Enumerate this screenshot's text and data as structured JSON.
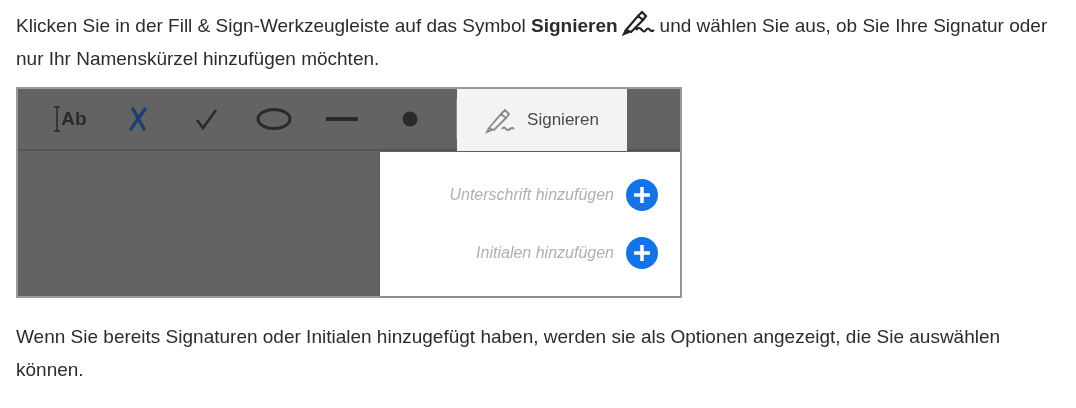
{
  "intro": {
    "before": "Klicken Sie in der Fill & Sign-Werkzeugleiste auf das Symbol **Signieren**",
    "after": "und wählen Sie aus, ob Sie Ihre Signatur oder nur Ihr Namenskürzel hinzufügen möchten."
  },
  "screenshot": {
    "tools": [
      {
        "kind": "text",
        "label": "Ab"
      },
      {
        "kind": "cross"
      },
      {
        "kind": "check"
      },
      {
        "kind": "ellipse"
      },
      {
        "kind": "line"
      },
      {
        "kind": "dot"
      }
    ],
    "sign_tab": {
      "label": "Signieren",
      "selected": true
    },
    "menu": [
      {
        "label": "Unterschrift hinzufügen"
      },
      {
        "label": "Initialen hinzufügen"
      }
    ]
  },
  "outro": "Wenn Sie bereits Signaturen oder Initialen hinzugefügt haben, werden sie als Optionen angezeigt, die Sie auswählen können."
}
